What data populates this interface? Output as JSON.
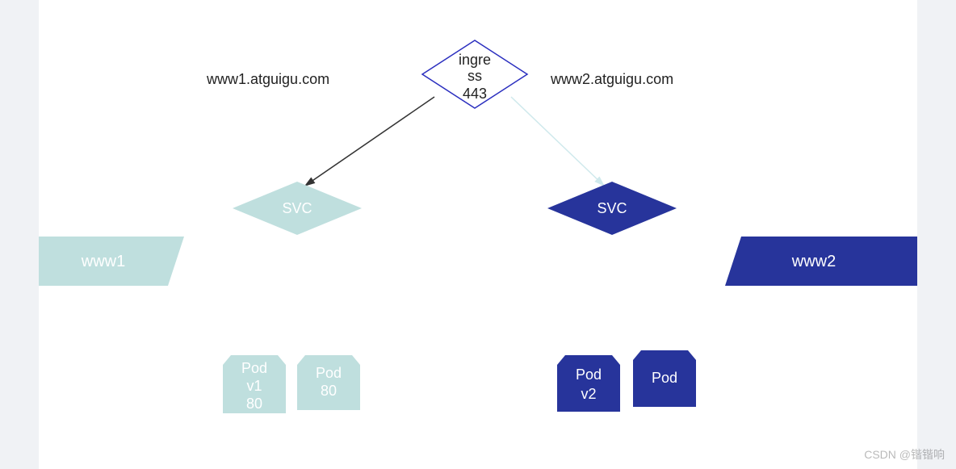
{
  "ingress": {
    "line1": "ingre",
    "line2": "ss",
    "port": "443"
  },
  "labels": {
    "left_host": "www1.atguigu.com",
    "right_host": "www2.atguigu.com"
  },
  "svc": {
    "left": "SVC",
    "right": "SVC"
  },
  "sites": {
    "left": "www1",
    "right": "www2"
  },
  "pods": {
    "left1_line1": "Pod",
    "left1_line2": "v1",
    "left1_line3": "80",
    "left2_line1": "Pod",
    "left2_line2": "80",
    "right1_line1": "Pod",
    "right1_line2": "v2",
    "right2_line1": "Pod"
  },
  "colors": {
    "teal": "#bfdfde",
    "navy": "#27349b",
    "ingress_stroke": "#2b2fbf",
    "arrow_dark": "#333",
    "arrow_light": "#cfe9ec"
  },
  "watermark": "CSDN @锴锴响"
}
